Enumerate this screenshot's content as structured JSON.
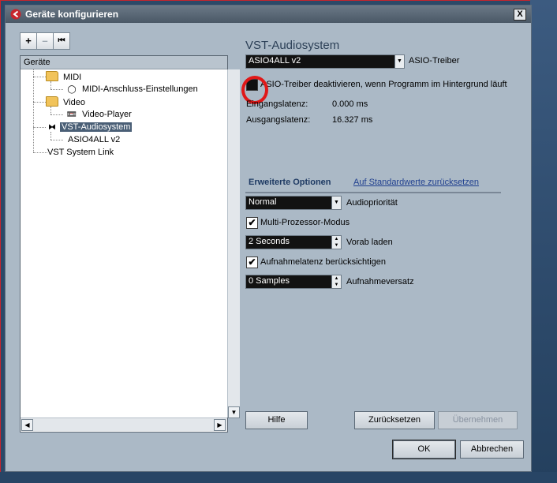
{
  "window": {
    "title": "Geräte konfigurieren",
    "close": "X"
  },
  "toolbar": {
    "add": "+",
    "remove": "–",
    "reset": "⏮"
  },
  "tree": {
    "header": "Geräte",
    "items": [
      {
        "label": "MIDI",
        "icon": "folder-icon"
      },
      {
        "label": "MIDI-Anschluss-Einstellungen",
        "icon": "midi-port-icon",
        "icon_glyph": "◯"
      },
      {
        "label": "Video",
        "icon": "folder-icon"
      },
      {
        "label": "Video-Player",
        "icon": "video-icon",
        "icon_glyph": "📼"
      },
      {
        "label": "VST-Audiosystem",
        "icon": "audio-icon",
        "icon_glyph": "⧓"
      },
      {
        "label": "ASIO4ALL v2",
        "icon": ""
      },
      {
        "label": "VST System Link",
        "icon": ""
      }
    ]
  },
  "panel": {
    "heading": "VST-Audiosystem",
    "driver_select": {
      "value": "ASIO4ALL v2",
      "label": "ASIO-Treiber"
    },
    "deactivate_checkbox": {
      "label": "ASIO-Treiber deaktivieren, wenn Programm im Hintergrund läuft",
      "checked": false
    },
    "input_latency": {
      "label": "Eingangslatenz:",
      "value": "0.000 ms"
    },
    "output_latency": {
      "label": "Ausgangslatenz:",
      "value": "16.327 ms"
    },
    "tabs": {
      "active": "Erweiterte Optionen",
      "reset_link": "Auf Standardwerte zurücksetzen"
    },
    "priority": {
      "value": "Normal",
      "label": "Audiopriorität"
    },
    "multiprocessor": {
      "label": "Multi-Prozessor-Modus",
      "checked": true
    },
    "preload": {
      "value": "2 Seconds",
      "label": "Vorab laden"
    },
    "record_latency": {
      "label": "Aufnahmelatenz berücksichtigen",
      "checked": true
    },
    "record_offset": {
      "value": "0 Samples",
      "label": "Aufnahmeversatz"
    }
  },
  "buttons": {
    "help": "Hilfe",
    "reset": "Zurücksetzen",
    "apply": "Übernehmen",
    "ok": "OK",
    "cancel": "Abbrechen"
  },
  "colors": {
    "highlight_circle": "#e01818",
    "selection": "#4a5f76"
  }
}
